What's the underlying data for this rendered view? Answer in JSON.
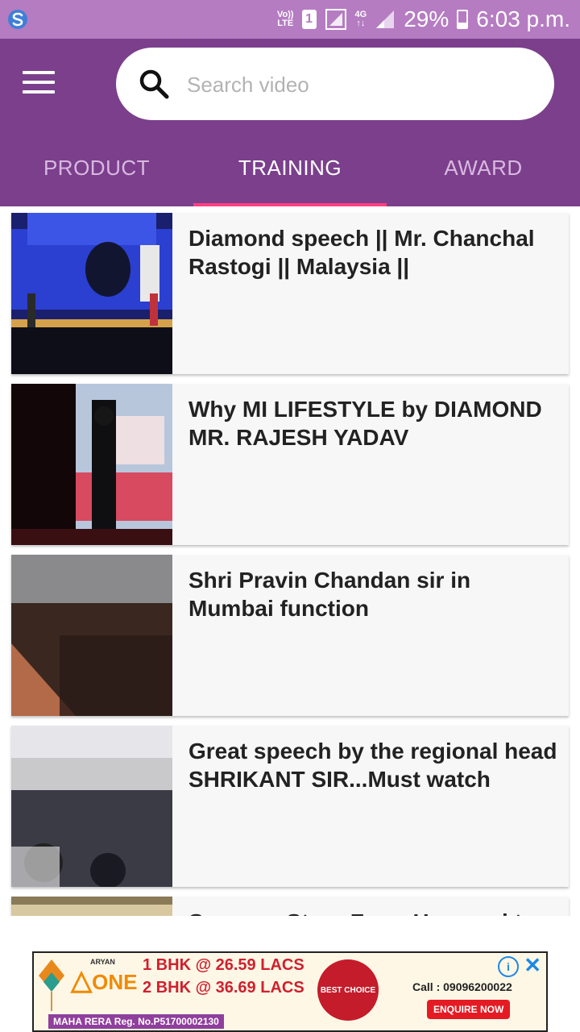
{
  "status_bar": {
    "volte_line1": "Vo))",
    "volte_line2": "LTE",
    "sim_slot": "1",
    "network_line1": "4G",
    "network_line2": "↑↓",
    "battery_percent": "29%",
    "battery_level": 0.29,
    "time": "6:03 p.m."
  },
  "toolbar": {
    "search_placeholder": "Search video"
  },
  "tabs": [
    {
      "label": "PRODUCT",
      "active": false
    },
    {
      "label": "TRAINING",
      "active": true
    },
    {
      "label": "AWARD",
      "active": false
    }
  ],
  "videos": [
    {
      "title": "Diamond speech || Mr. Chanchal Rastogi || Malaysia ||"
    },
    {
      "title": "Why MI LIFESTYLE by DIAMOND MR. RAJESH YADAV"
    },
    {
      "title": "Shri Pravin Chandan sir in Mumbai function"
    },
    {
      "title": "Great speech by the regional head SHRIKANT SIR...Must watch"
    },
    {
      "title": "Success Story From Haryanvi to..."
    }
  ],
  "ad": {
    "brand": "ONE",
    "brand_top": "ARYAN",
    "line1": "1 BHK @ 26.59 LACS",
    "line2": "2 BHK @ 36.69 LACS",
    "badge": "BEST CHOICE",
    "call": "Call : 09096200022",
    "enquire": "ENQUIRE NOW",
    "rera": "MAHA RERA Reg. No.P51700002130",
    "info_glyph": "i",
    "close_glyph": "✕"
  },
  "colors": {
    "status_bar": "#b57cc2",
    "toolbar": "#7b3f8c",
    "tab_indicator": "#ff4081"
  }
}
